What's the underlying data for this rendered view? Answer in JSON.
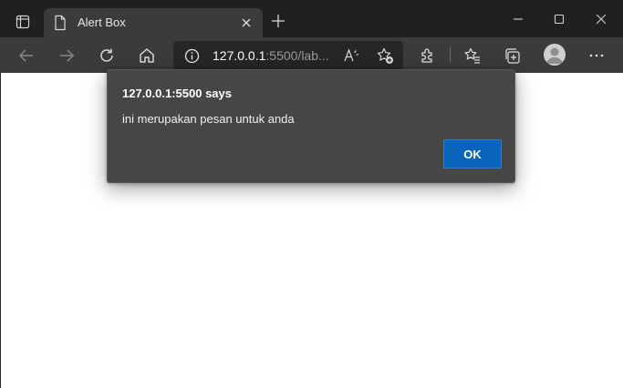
{
  "tab": {
    "title": "Alert Box"
  },
  "address_bar": {
    "url_host": "127.0.0.1",
    "url_rest": ":5500/lab..."
  },
  "icons": {
    "tab_actions": "tab-actions-icon",
    "favicon": "page-icon",
    "tab_close": "close-icon",
    "new_tab": "plus-icon",
    "minimize": "minimize-icon",
    "maximize": "maximize-icon",
    "close_window": "close-icon",
    "back": "arrow-left-icon",
    "forward": "arrow-right-icon",
    "refresh": "refresh-icon",
    "home": "home-icon",
    "site_info": "info-icon",
    "read_aloud": "read-aloud-icon",
    "add_favorite": "star-add-icon",
    "extensions": "puzzle-icon",
    "favorites": "favorites-icon",
    "collections": "collections-icon",
    "profile": "avatar",
    "more": "more-icon"
  },
  "alert": {
    "title": "127.0.0.1:5500 says",
    "message": "ini merupakan pesan untuk anda",
    "ok_label": "OK"
  },
  "colors": {
    "titlebar": "#202020",
    "toolbar": "#3b3b3b",
    "omnibox": "#262626",
    "dialog": "#464646",
    "accent": "#0a64bc",
    "page": "#ffffff"
  }
}
